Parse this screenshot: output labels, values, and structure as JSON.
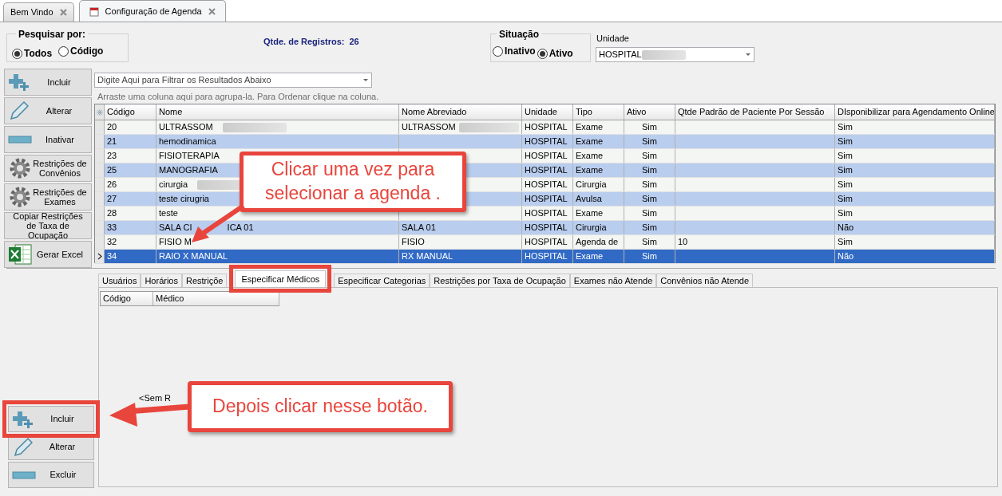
{
  "tabs": [
    {
      "label": "Bem Vindo",
      "selected": false
    },
    {
      "label": "Configuração de Agenda",
      "selected": true
    }
  ],
  "search_by": {
    "title": "Pesquisar por:",
    "options": [
      {
        "label": "Todos",
        "selected": true
      },
      {
        "label": "Código",
        "selected": false
      }
    ]
  },
  "record_count": {
    "label": "Qtde. de Registros:",
    "value": "26"
  },
  "situacao": {
    "title": "Situação",
    "options": [
      {
        "label": "Inativo",
        "selected": false
      },
      {
        "label": "Ativo",
        "selected": true
      }
    ]
  },
  "unidade": {
    "label": "Unidade",
    "value": "HOSPITAL",
    "blurred": true
  },
  "actions": [
    {
      "label": "Incluir",
      "kind": "add"
    },
    {
      "label": "Alterar",
      "kind": "edit"
    },
    {
      "label": "Inativar",
      "kind": "remove"
    },
    {
      "label": "Restrições de Convênios",
      "kind": "settings"
    },
    {
      "label": "Restrições de Exames",
      "kind": "settings"
    },
    {
      "label": "Copiar Restrições de Taxa de Ocupação",
      "kind": "text"
    },
    {
      "label": "Gerar Excel",
      "kind": "export"
    }
  ],
  "filter": {
    "placeholder": "Digite Aqui para Filtrar os Resultados Abaixo"
  },
  "group_hint": "Arraste uma coluna aqui para agrupa-la. Para Ordenar clique na coluna.",
  "table": {
    "columns": [
      "Código",
      "Nome",
      "Nome Abreviado",
      "Unidade",
      "Tipo",
      "Ativo",
      "Qtde Padrão de Paciente Por Sessão",
      "DIsponibilizar para Agendamento Online"
    ],
    "rows": [
      {
        "selected": false,
        "cells": [
          "20",
          {
            "text": "ULTRASSOM",
            "blurred": true
          },
          {
            "text": "ULTRASSOM",
            "blurred": true
          },
          "HOSPITAL",
          "Exame",
          "Sim",
          null,
          "Sim"
        ]
      },
      {
        "selected": false,
        "cells": [
          "21",
          "hemodinamica",
          null,
          "HOSPITAL",
          "Exame",
          "Sim",
          null,
          "Sim"
        ]
      },
      {
        "selected": false,
        "cells": [
          "23",
          "FISIOTERAPIA",
          null,
          "HOSPITAL",
          "Exame",
          "Sim",
          null,
          "Sim"
        ]
      },
      {
        "selected": false,
        "cells": [
          "25",
          "MANOGRAFIA",
          null,
          "HOSPITAL",
          "Exame",
          "Sim",
          null,
          "Sim"
        ]
      },
      {
        "selected": false,
        "cells": [
          "26",
          {
            "text": "cirurgia",
            "blurred": true
          },
          null,
          "HOSPITAL",
          "Cirurgia",
          "Sim",
          null,
          "Sim"
        ]
      },
      {
        "selected": false,
        "cells": [
          "27",
          "teste cirugria",
          null,
          "HOSPITAL",
          "Avulsa",
          "Sim",
          null,
          "Sim"
        ]
      },
      {
        "selected": false,
        "cells": [
          "28",
          "teste",
          null,
          "HOSPITAL",
          "Exame",
          "Sim",
          null,
          "Sim"
        ]
      },
      {
        "selected": false,
        "cells": [
          "33",
          {
            "parts": [
              "SALA CI",
              "ICA 01"
            ]
          },
          "SALA 01",
          "HOSPITAL",
          "Cirurgia",
          "Sim",
          null,
          "Não"
        ]
      },
      {
        "selected": false,
        "cells": [
          "32",
          "FISIO M",
          "FISIO",
          "HOSPITAL",
          "Agenda de",
          "Sim",
          "10",
          "Sim"
        ]
      },
      {
        "selected": true,
        "cells": [
          "34",
          "RAIO X MANUAL",
          "RX MANUAL",
          "HOSPITAL",
          "Exame",
          "Sim",
          null,
          "Não"
        ]
      }
    ]
  },
  "detail_tabs": [
    {
      "label": "Usuários",
      "selected": false
    },
    {
      "label": "Horários",
      "selected": false
    },
    {
      "label": "Restriçõe",
      "selected": false
    },
    {
      "label": "Especificar Médicos",
      "selected": true
    },
    {
      "label": "Especificar Categorias",
      "selected": false
    },
    {
      "label": "Restrições por Taxa de Ocupação",
      "selected": false
    },
    {
      "label": "Exames não Atende",
      "selected": false
    },
    {
      "label": "Convênios não Atende",
      "selected": false
    }
  ],
  "detail_grid": {
    "columns": [
      "Código",
      "Médico"
    ],
    "empty_text": "<Sem R"
  },
  "detail_actions": [
    {
      "label": "Incluir",
      "kind": "add"
    },
    {
      "label": "Alterar",
      "kind": "edit"
    },
    {
      "label": "Excluir",
      "kind": "remove"
    }
  ],
  "callouts": [
    {
      "text": "Clicar uma vez para selecionar a agenda ."
    },
    {
      "text": "Depois clicar nesse botão."
    }
  ]
}
